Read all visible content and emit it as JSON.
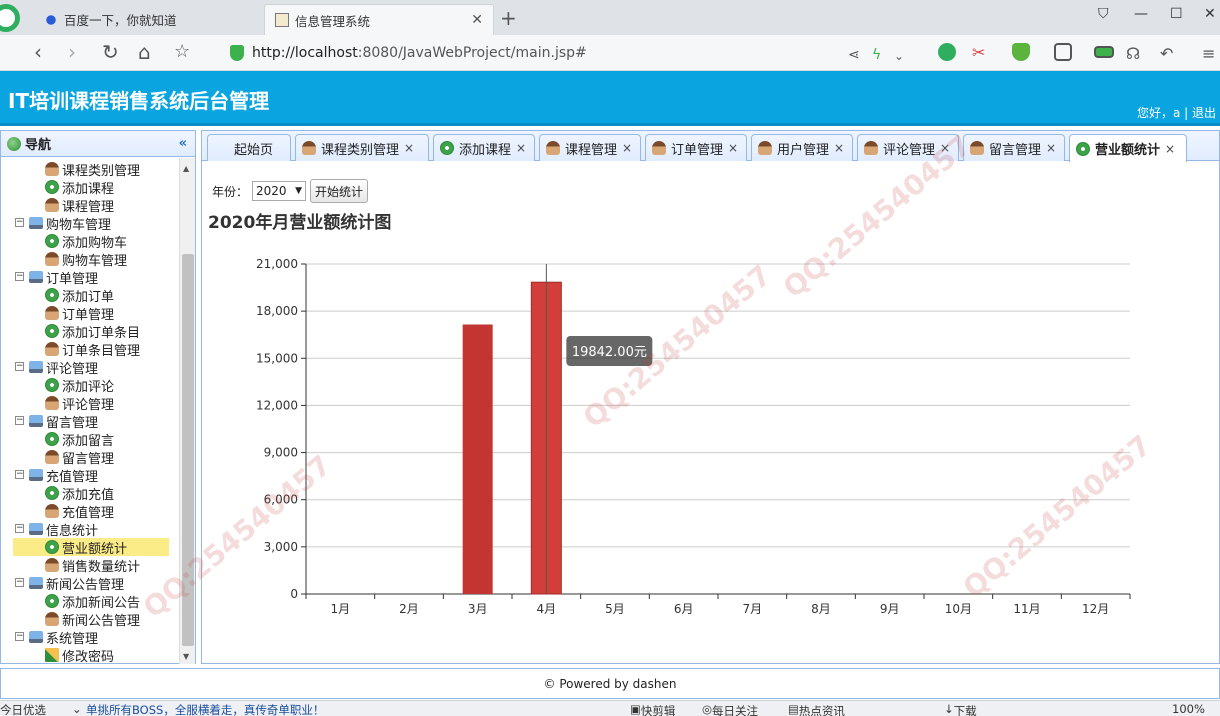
{
  "browser": {
    "tabs": [
      {
        "title": "百度一下，你就知道",
        "active": false
      },
      {
        "title": "信息管理系统",
        "active": true
      }
    ],
    "url_host": "http://localhost",
    "url_rest": ":8080/JavaWebProject/main.jsp#"
  },
  "app": {
    "title": "IT培训课程销售系统后台管理",
    "welcome": "您好，a",
    "logout": "退出"
  },
  "nav": {
    "title": "导航",
    "collapse_icon": "«",
    "items": [
      {
        "label": "课程类别管理",
        "icon": "person",
        "level": 2
      },
      {
        "label": "添加课程",
        "icon": "add",
        "level": 2
      },
      {
        "label": "课程管理",
        "icon": "person",
        "level": 2
      },
      {
        "label": "购物车管理",
        "icon": "pc",
        "level": 1
      },
      {
        "label": "添加购物车",
        "icon": "add",
        "level": 2
      },
      {
        "label": "购物车管理",
        "icon": "person",
        "level": 2
      },
      {
        "label": "订单管理",
        "icon": "pc",
        "level": 1
      },
      {
        "label": "添加订单",
        "icon": "add",
        "level": 2
      },
      {
        "label": "订单管理",
        "icon": "person",
        "level": 2
      },
      {
        "label": "添加订单条目",
        "icon": "add",
        "level": 2
      },
      {
        "label": "订单条目管理",
        "icon": "person",
        "level": 2
      },
      {
        "label": "评论管理",
        "icon": "pc",
        "level": 1
      },
      {
        "label": "添加评论",
        "icon": "add",
        "level": 2
      },
      {
        "label": "评论管理",
        "icon": "person",
        "level": 2
      },
      {
        "label": "留言管理",
        "icon": "pc",
        "level": 1
      },
      {
        "label": "添加留言",
        "icon": "add",
        "level": 2
      },
      {
        "label": "留言管理",
        "icon": "person",
        "level": 2
      },
      {
        "label": "充值管理",
        "icon": "pc",
        "level": 1
      },
      {
        "label": "添加充值",
        "icon": "add",
        "level": 2
      },
      {
        "label": "充值管理",
        "icon": "person",
        "level": 2
      },
      {
        "label": "信息统计",
        "icon": "pc",
        "level": 1
      },
      {
        "label": "营业额统计",
        "icon": "add",
        "level": 2,
        "selected": true
      },
      {
        "label": "销售数量统计",
        "icon": "person",
        "level": 2
      },
      {
        "label": "新闻公告管理",
        "icon": "pc",
        "level": 1
      },
      {
        "label": "添加新闻公告",
        "icon": "add",
        "level": 2
      },
      {
        "label": "新闻公告管理",
        "icon": "person",
        "level": 2
      },
      {
        "label": "系统管理",
        "icon": "pc",
        "level": 1
      },
      {
        "label": "修改密码",
        "icon": "pencil",
        "level": 2
      }
    ]
  },
  "tabs": [
    {
      "label": "起始页",
      "icon": "",
      "closable": false
    },
    {
      "label": "课程类别管理",
      "icon": "person",
      "closable": true
    },
    {
      "label": "添加课程",
      "icon": "add",
      "closable": true
    },
    {
      "label": "课程管理",
      "icon": "person",
      "closable": true
    },
    {
      "label": "订单管理",
      "icon": "person",
      "closable": true
    },
    {
      "label": "用户管理",
      "icon": "person",
      "closable": true
    },
    {
      "label": "评论管理",
      "icon": "person",
      "closable": true
    },
    {
      "label": "留言管理",
      "icon": "person",
      "closable": true
    },
    {
      "label": "营业额统计",
      "icon": "add",
      "closable": true,
      "active": true
    }
  ],
  "filter": {
    "year_label": "年份：",
    "year_value": "2020",
    "start_button": "开始统计"
  },
  "chart_data": {
    "type": "bar",
    "title": "2020年月营业额统计图",
    "categories": [
      "1月",
      "2月",
      "3月",
      "4月",
      "5月",
      "6月",
      "7月",
      "8月",
      "9月",
      "10月",
      "11月",
      "12月"
    ],
    "values": [
      0,
      0,
      17150,
      19842,
      0,
      0,
      0,
      0,
      0,
      0,
      0,
      0
    ],
    "ylim": [
      0,
      21000
    ],
    "yticks": [
      "0",
      "3,000",
      "6,000",
      "9,000",
      "12,000",
      "15,000",
      "18,000",
      "21,000"
    ],
    "grid": true,
    "bar_color": "#c23531",
    "tooltip": "19842.00元",
    "tooltip_index": 3
  },
  "footer": "© Powered by dashen",
  "statusbar": {
    "left": "今日优选",
    "ticker": "单挑所有BOSS，全服横着走，真传奇单职业！",
    "items": [
      "快剪辑",
      "每日关注",
      "热点资讯",
      "下载",
      "100%"
    ]
  }
}
